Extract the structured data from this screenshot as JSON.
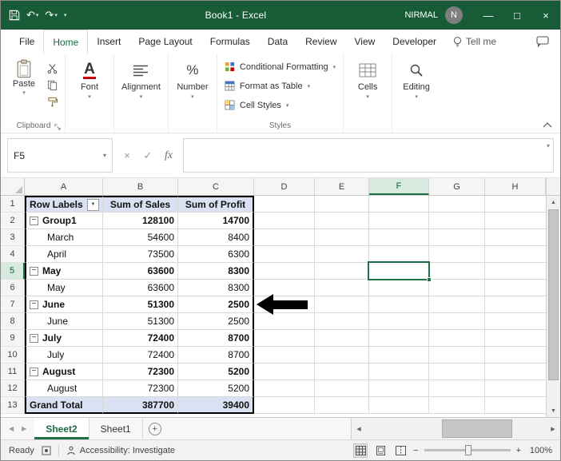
{
  "titlebar": {
    "title": "Book1 - Excel",
    "user": "NIRMAL",
    "avatar_initial": "N"
  },
  "menu": {
    "tabs": [
      "File",
      "Home",
      "Insert",
      "Page Layout",
      "Formulas",
      "Data",
      "Review",
      "View",
      "Developer"
    ],
    "active_tab": "Home",
    "tell_me": "Tell me"
  },
  "ribbon": {
    "paste": "Paste",
    "clipboard": "Clipboard",
    "font": "Font",
    "alignment": "Alignment",
    "number": "Number",
    "conditional_formatting": "Conditional Formatting",
    "format_as_table": "Format as Table",
    "cell_styles": "Cell Styles",
    "styles": "Styles",
    "cells": "Cells",
    "editing": "Editing"
  },
  "formula": {
    "name_box": "F5",
    "fx": "fx",
    "value": ""
  },
  "sheet": {
    "columns": [
      "A",
      "B",
      "C",
      "D",
      "E",
      "F",
      "G",
      "H"
    ],
    "selected_cell": "F5",
    "rows": [
      {
        "n": "1",
        "a": "Row Labels",
        "b": "Sum of Sales",
        "c": "Sum of Profit"
      },
      {
        "n": "2",
        "a": "Group1",
        "b": "128100",
        "c": "14700"
      },
      {
        "n": "3",
        "a": "March",
        "b": "54600",
        "c": "8400"
      },
      {
        "n": "4",
        "a": "April",
        "b": "73500",
        "c": "6300"
      },
      {
        "n": "5",
        "a": "May",
        "b": "63600",
        "c": "8300"
      },
      {
        "n": "6",
        "a": "May",
        "b": "63600",
        "c": "8300"
      },
      {
        "n": "7",
        "a": "June",
        "b": "51300",
        "c": "2500"
      },
      {
        "n": "8",
        "a": "June",
        "b": "51300",
        "c": "2500"
      },
      {
        "n": "9",
        "a": "July",
        "b": "72400",
        "c": "8700"
      },
      {
        "n": "10",
        "a": "July",
        "b": "72400",
        "c": "8700"
      },
      {
        "n": "11",
        "a": "August",
        "b": "72300",
        "c": "5200"
      },
      {
        "n": "12",
        "a": "August",
        "b": "72300",
        "c": "5200"
      },
      {
        "n": "13",
        "a": "Grand Total",
        "b": "387700",
        "c": "39400"
      }
    ]
  },
  "sheetbar": {
    "sheet2": "Sheet2",
    "sheet1": "Sheet1",
    "active": "Sheet2"
  },
  "statusbar": {
    "mode": "Ready",
    "accessibility": "Accessibility: Investigate",
    "zoom": "100%"
  },
  "colors": {
    "titlebar_green": "#185C37",
    "selection_green": "#1E7145",
    "pivot_header_blue": "#D9E1F2"
  },
  "icons": {
    "caret_down": "▾",
    "filter_caret": "▼",
    "undo": "↶",
    "redo": "↷",
    "minimize": "—",
    "maximize": "□",
    "close": "×",
    "cancel": "×",
    "check": "✓",
    "collapse_minus": "−",
    "percent": "%",
    "font_letter": "A",
    "scroll_up": "▲",
    "scroll_down": "▼",
    "scroll_left": "◀",
    "scroll_right": "▶",
    "nav_left": "◀",
    "nav_right": "▶",
    "zoom_out": "−",
    "zoom_in": "+",
    "add_sheet": "+"
  }
}
